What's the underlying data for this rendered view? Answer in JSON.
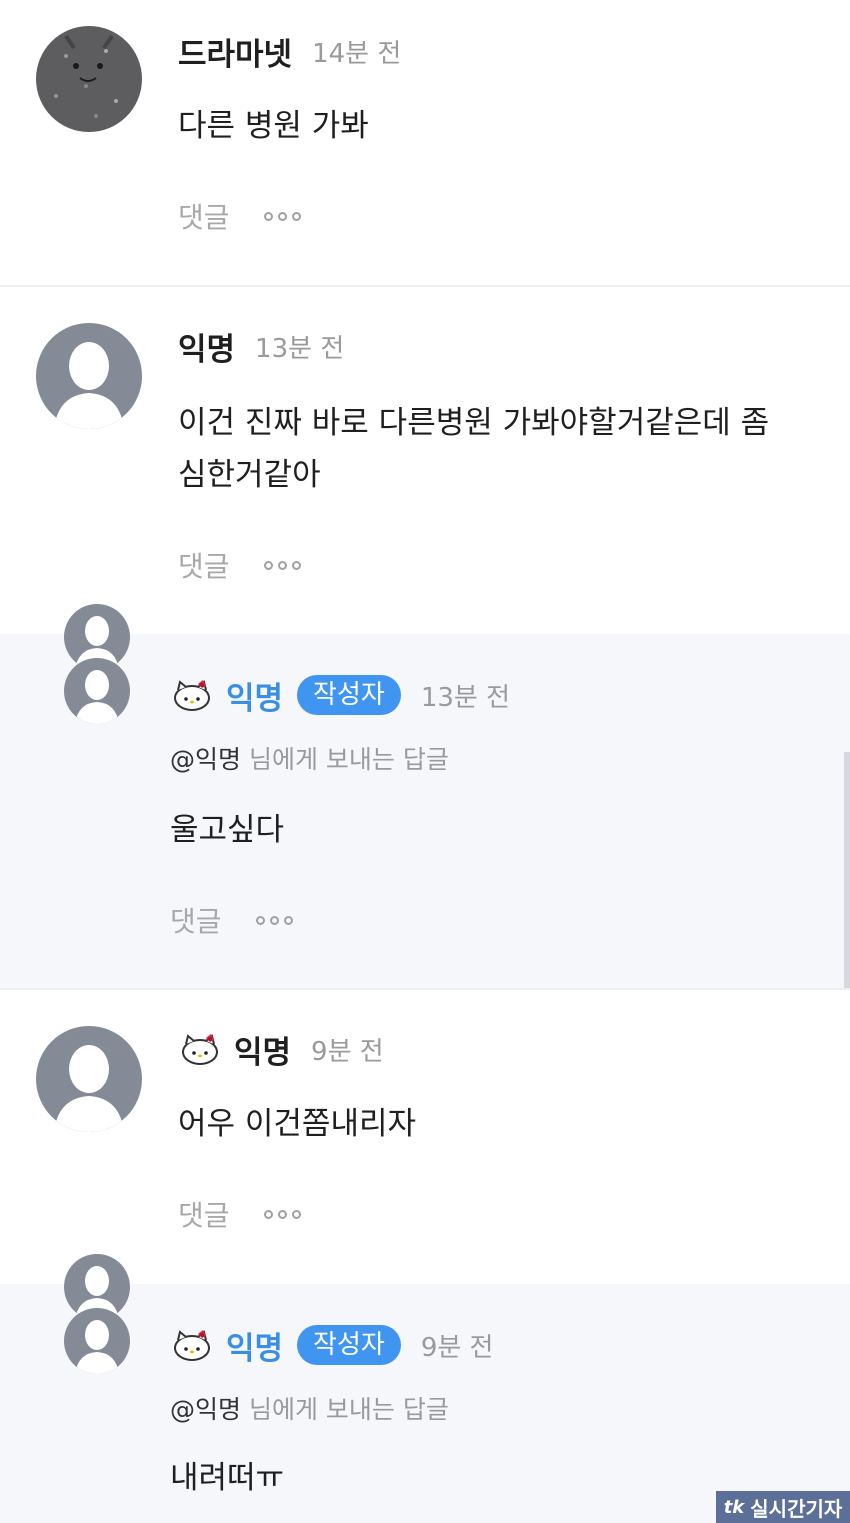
{
  "comments": [
    {
      "name": "드라마넷",
      "time": "14분 전",
      "text": "다른 병원 가봐"
    },
    {
      "name": "익명",
      "time": "13분 전",
      "text_line1": "이건 진짜 바로 다른병원 가봐야할거같은데 좀",
      "text_line2": "심한거같아"
    },
    {
      "name": "익명",
      "badge": "작성자",
      "time": "13분 전",
      "mention_user": "@익명",
      "mention_suffix": "님에게 보내는 답글",
      "text": "울고싶다"
    },
    {
      "name": "익명",
      "time": "9분 전",
      "text": "어우 이건쫌내리자"
    },
    {
      "name": "익명",
      "badge": "작성자",
      "time": "9분 전",
      "mention_user": "@익명",
      "mention_suffix": "님에게 보내는 답글",
      "text": "내려떠ㅠ"
    }
  ],
  "actions": {
    "reply_label": "댓글"
  },
  "watermark": {
    "logo": "tk",
    "text": "실시간기자"
  },
  "colors": {
    "accent": "#3f95ef",
    "reply_bg": "#f5f7fb",
    "muted": "#9a9a9a"
  },
  "icons": [
    "default-avatar-icon",
    "hello-kitty-icon",
    "more-dots-icon"
  ]
}
